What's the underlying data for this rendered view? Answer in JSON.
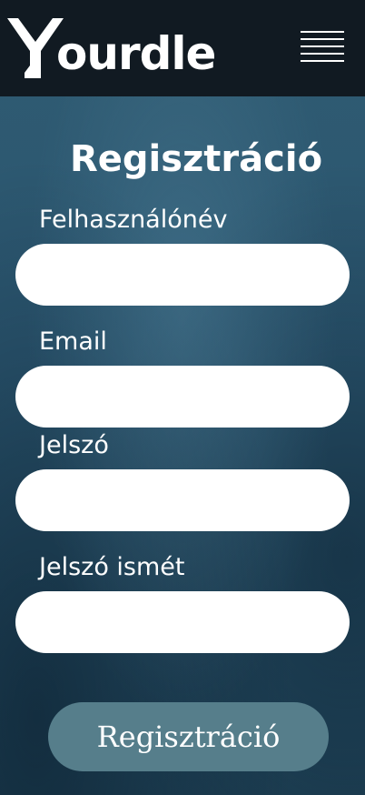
{
  "header": {
    "logo_text": "ourdle",
    "logo_icon": "y-logo-icon",
    "menu_icon": "hamburger-menu-icon"
  },
  "form": {
    "title": "Regisztráció",
    "fields": [
      {
        "label": "Felhasználónév",
        "value": "",
        "placeholder": ""
      },
      {
        "label": "Email",
        "value": "",
        "placeholder": ""
      },
      {
        "label": "Jelszó",
        "value": "",
        "placeholder": ""
      },
      {
        "label": "Jelszó ismét",
        "value": "",
        "placeholder": ""
      }
    ],
    "submit_label": "Regisztráció"
  },
  "colors": {
    "header_bg": "#111a22",
    "page_bg": "#2b5670",
    "button_bg": "#567e8b",
    "input_bg": "#ffffff",
    "text": "#ffffff"
  }
}
